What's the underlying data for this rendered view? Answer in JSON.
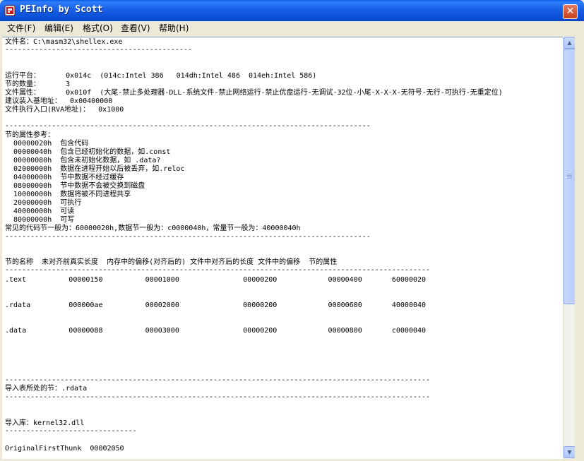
{
  "window": {
    "title": "PEInfo by Scott",
    "close_label": "✕"
  },
  "menu": [
    {
      "label": "文件(F)"
    },
    {
      "label": "编辑(E)"
    },
    {
      "label": "格式(O)"
    },
    {
      "label": "查看(V)"
    },
    {
      "label": "帮助(H)"
    }
  ],
  "content": {
    "lines": [
      "文件名：C:\\masm32\\shellex.exe",
      "--------------------------------------------",
      "运行平台：      0x014c  (014c:Intel 386   014dh:Intel 486  014eh:Intel 586)",
      "节的数量：      3",
      "文件属性：      0x010f  (大尾-禁止多处理器-DLL-系统文件-禁止网络运行-禁止优盘运行-无调试-32位-小尾-X-X-X-无符号-无行-可执行-无重定位)",
      "建议装入基地址：  0x00400000",
      "文件执行入口(RVA地址)：  0x1000",
      "--------------------------------------------------------------------------------------",
      "节的属性参考：",
      "  00000020h  包含代码",
      "  00000040h  包含已经初始化的数据，如.const",
      "  00000080h  包含未初始化数据，如 .data?",
      "  02000000h  数据在进程开始以后被丢弃，如.reloc",
      "  04000000h  节中数据不经过缓存",
      "  08000000h  节中数据不会被交换到磁盘",
      "  10000000h  数据将被不同进程共享",
      "  20000000h  可执行",
      "  40000000h  可读",
      "  80000000h  可写",
      "常见的代码节一般为：60000020h,数据节一般为：c0000040h，常量节一般为：40000040h",
      "--------------------------------------------------------------------------------------",
      "节的名称  未对齐前真实长度  内存中的偏移(对齐后的) 文件中对齐后的长度 文件中的偏移  节的属性",
      "----------------------------------------------------------------------------------------------------",
      ".text          00000150          00001000               00000200            00000400       60000020",
      ".rdata         000000ae          00002000               00000200            00000600       40000040",
      ".data          00000088          00003000               00000200            00000800       c0000040",
      "----------------------------------------------------------------------------------------------------",
      "导入表所处的节：.rdata",
      "----------------------------------------------------------------------------------------------------",
      "导入库：kernel32.dll",
      "-------------------------------",
      "OriginalFirstThunk  00002050"
    ]
  }
}
